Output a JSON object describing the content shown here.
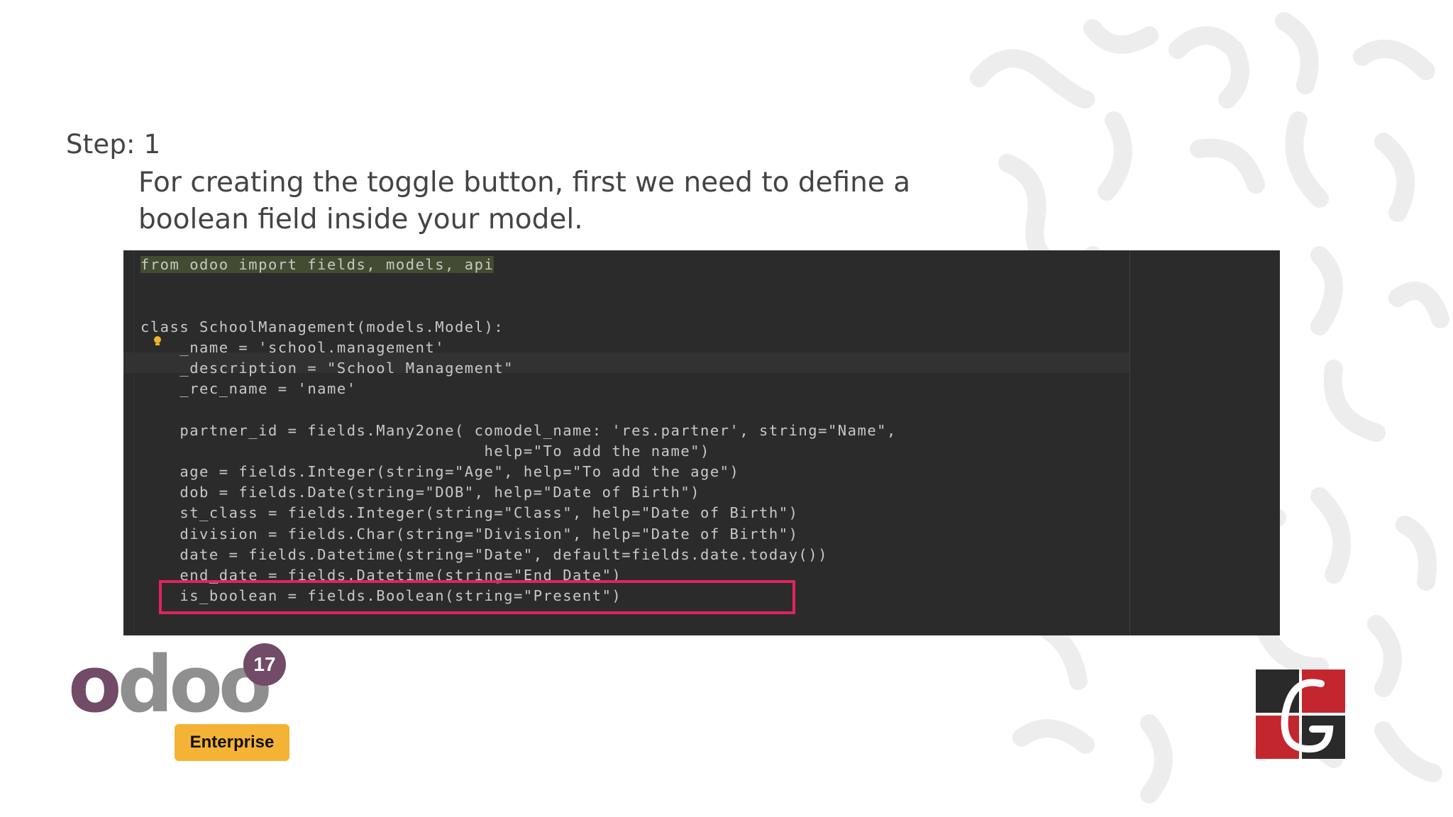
{
  "slide": {
    "step_label": "Step: 1",
    "description": "For creating the toggle button, first we need to define a boolean field inside your model."
  },
  "code": {
    "line1": "from odoo import fields, models, api",
    "class_line": "class SchoolManagement(models.Model):",
    "name_line": "_name = 'school.management'",
    "description_line": "_description = \"School Management\"",
    "rec_name_line": "_rec_name = 'name'",
    "partner_line_1": "partner_id = fields.Many2one( comodel_name: 'res.partner', string=\"Name\",",
    "partner_line_2": "help=\"To add the name\")",
    "age_line": "age = fields.Integer(string=\"Age\", help=\"To add the age\")",
    "dob_line": "dob = fields.Date(string=\"DOB\", help=\"Date of Birth\")",
    "st_class_line": "st_class = fields.Integer(string=\"Class\", help=\"Date of Birth\")",
    "division_line": "division = fields.Char(string=\"Division\", help=\"Date of Birth\")",
    "date_line": "date = fields.Datetime(string=\"Date\", default=fields.date.today())",
    "end_date_line": "end_date = fields.Datetime(string=\"End Date\")",
    "is_boolean_line": "is_boolean = fields.Boolean(string=\"Present\")"
  },
  "branding": {
    "product_name": "odoo",
    "version_badge": "17",
    "edition_label": "Enterprise",
    "brand_purple": "#714b67",
    "edition_color": "#f5b335",
    "highlight_color": "#e0245e"
  }
}
